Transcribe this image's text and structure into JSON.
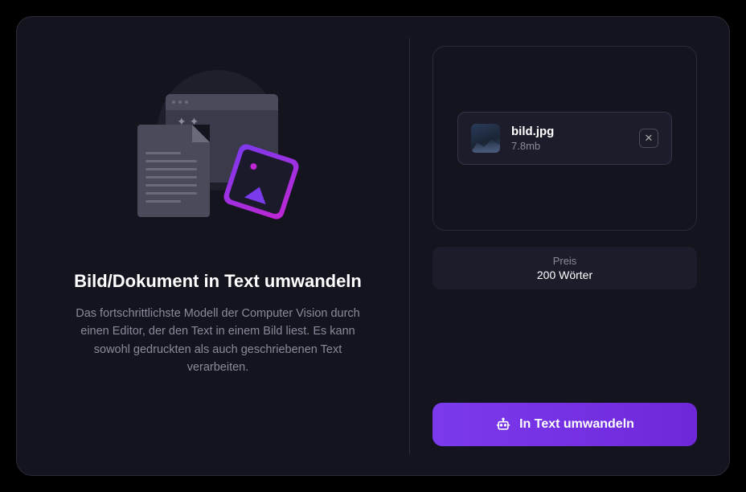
{
  "left": {
    "heading": "Bild/Dokument in Text umwandeln",
    "description": "Das fortschrittlichste Modell der Computer Vision durch einen Editor, der den Text in einem Bild liest. Es kann sowohl gedruckten als auch geschriebenen Text verarbeiten."
  },
  "file": {
    "name": "bild.jpg",
    "size": "7.8mb"
  },
  "price": {
    "label": "Preis",
    "value": "200 Wörter"
  },
  "action": {
    "convert_label": "In Text umwandeln"
  }
}
